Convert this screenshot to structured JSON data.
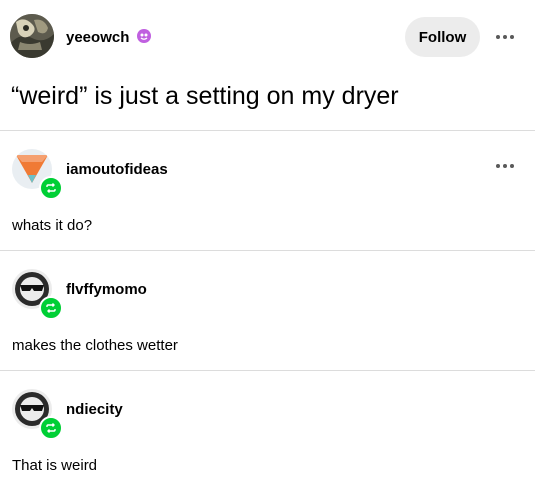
{
  "post": {
    "author": "yeeowch",
    "follow_label": "Follow",
    "title": "“weird” is just a setting on my dryer"
  },
  "replies": [
    {
      "username": "iamoutofideas",
      "text": "whats it do?",
      "has_menu": true
    },
    {
      "username": "flvffymomo",
      "text": "makes the clothes wetter",
      "has_menu": false
    },
    {
      "username": "ndiecity",
      "text": "That is weird",
      "has_menu": false
    }
  ],
  "colors": {
    "follow_bg": "#ececec",
    "reblog_green": "#00cf35",
    "divider": "#dcdcdc",
    "badge_purple": "#c060e0"
  },
  "icons": {
    "more": "more-horizontal-icon",
    "reblog": "reblog-icon",
    "badge": "blob-badge-icon"
  }
}
